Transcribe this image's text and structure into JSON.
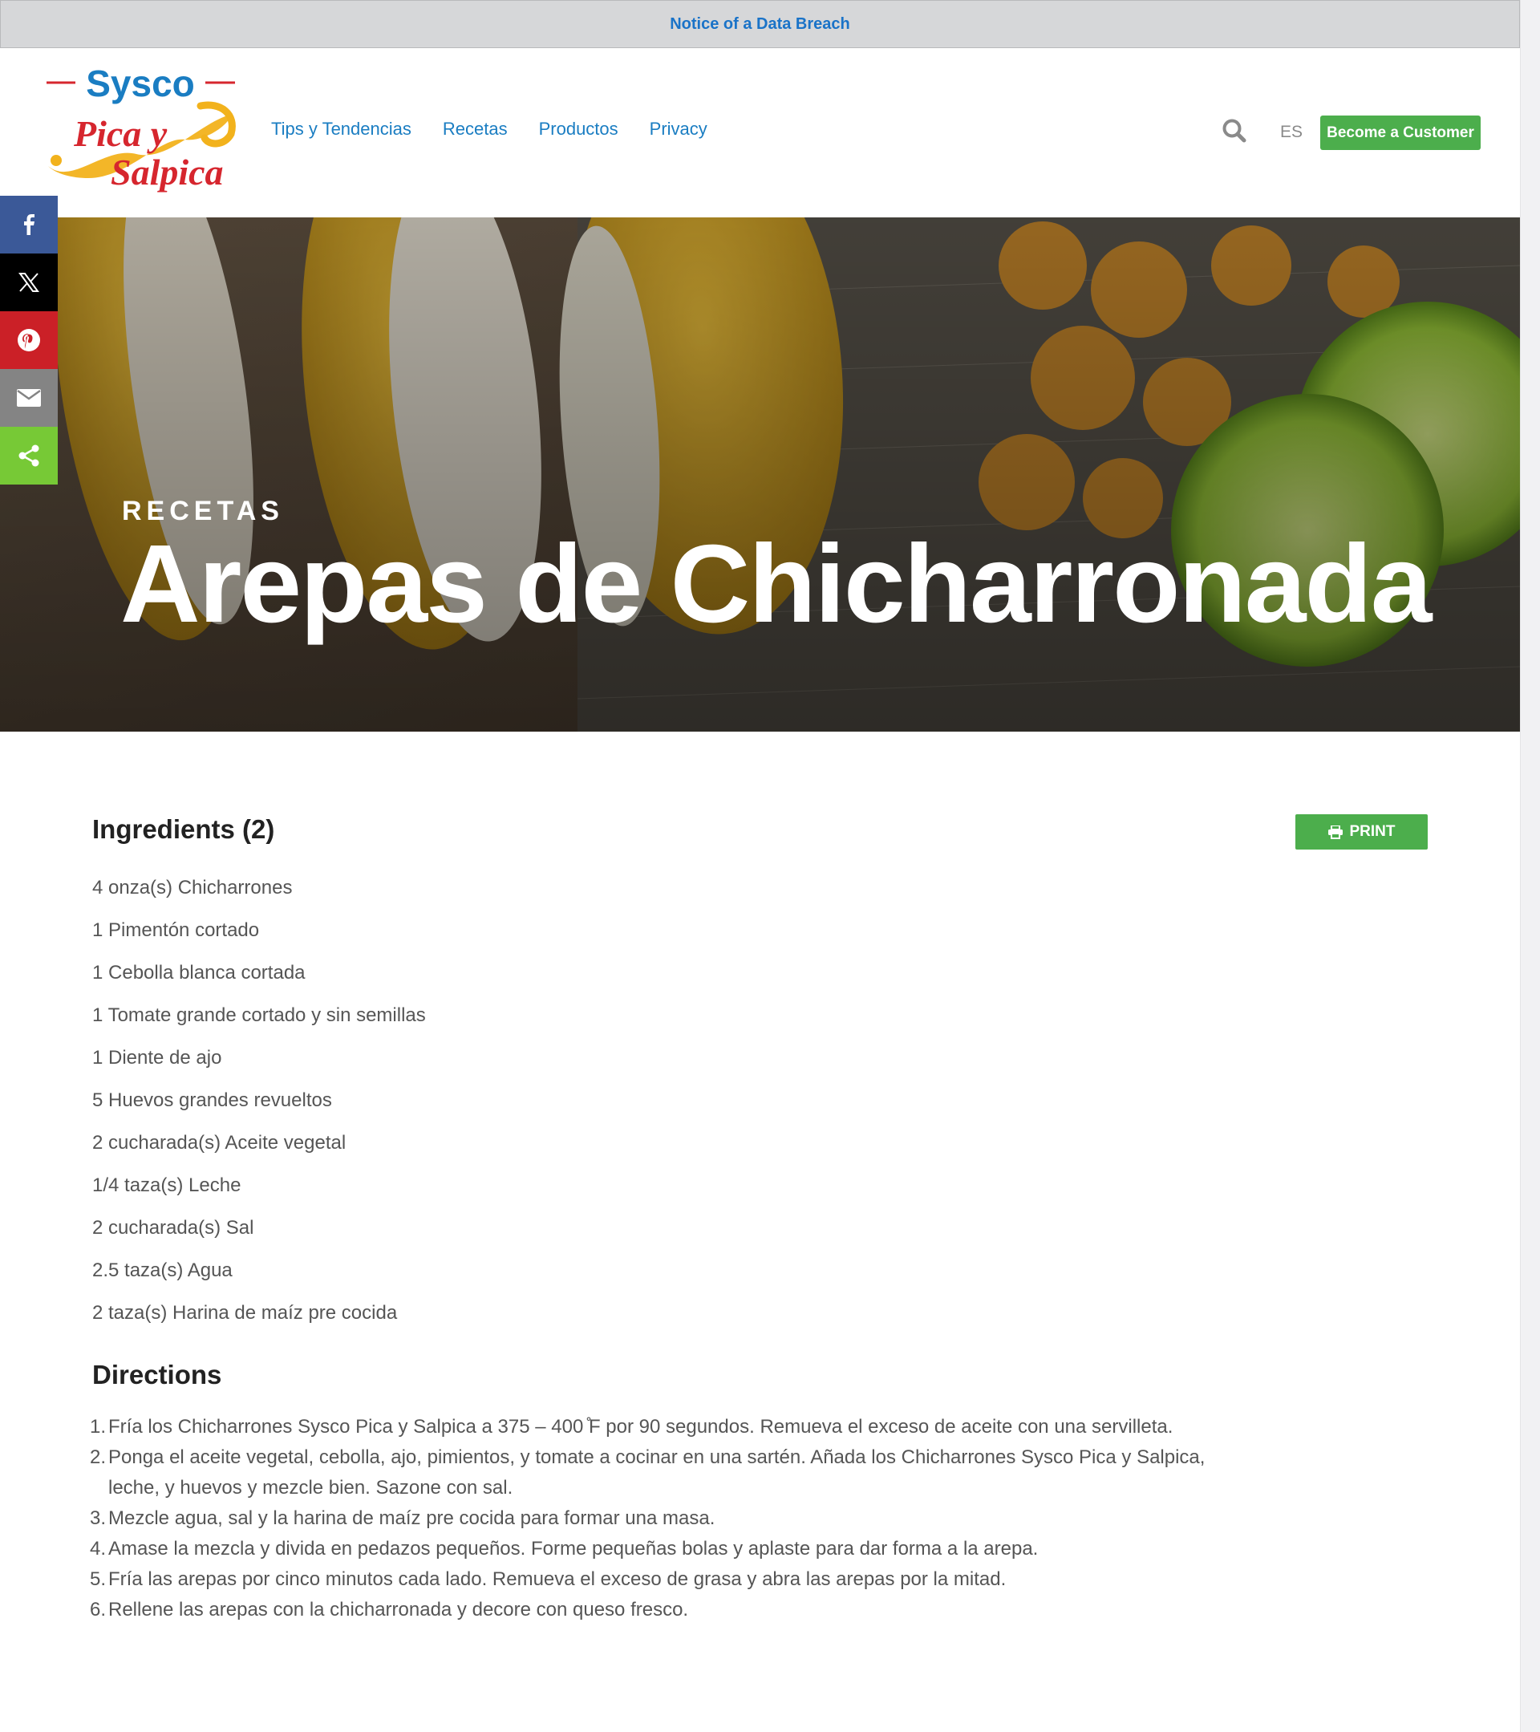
{
  "notice": {
    "text": "Notice of a Data Breach"
  },
  "logo": {
    "brand_top": "Sysco",
    "brand_line1": "Pica y",
    "brand_line2": "Salpica"
  },
  "nav": {
    "items": [
      "Tips y Tendencias",
      "Recetas",
      "Productos",
      "Privacy"
    ]
  },
  "header": {
    "search_icon": "search-icon",
    "lang": "ES",
    "customer_button": "Become a Customer"
  },
  "share": {
    "icons": [
      "facebook-icon",
      "x-icon",
      "pinterest-icon",
      "email-icon",
      "share-icon"
    ]
  },
  "hero": {
    "kicker": "RECETAS",
    "title": "Arepas de Chicharronada"
  },
  "ingredients": {
    "title": "Ingredients (2)",
    "print_label": "PRINT",
    "items": [
      "4 onza(s) Chicharrones",
      "1 Pimentón cortado",
      "1 Cebolla blanca cortada",
      "1 Tomate grande cortado y sin semillas",
      "1 Diente de ajo",
      "5 Huevos grandes revueltos",
      "2 cucharada(s) Aceite vegetal",
      "1/4 taza(s) Leche",
      "2 cucharada(s) Sal",
      "2.5 taza(s) Agua",
      "2 taza(s) Harina de maíz pre cocida"
    ]
  },
  "directions": {
    "title": "Directions",
    "steps": [
      "Fría los Chicharrones Sysco Pica y Salpica a 375 – 400 ̊F por 90 segundos. Remueva el exceso de aceite con una servilleta.",
      "Ponga el aceite vegetal, cebolla, ajo, pimientos, y tomate a cocinar en una sartén. Añada los Chicharrones Sysco Pica y Salpica, leche, y huevos y mezcle bien. Sazone con sal.",
      "Mezcle agua, sal y la harina de maíz pre cocida para formar una masa.",
      "Amase la mezcla y divida en pedazos pequeños. Forme pequeñas bolas y aplaste para dar forma a la arepa.",
      "Fría las arepas por cinco minutos cada lado. Remueva el exceso de grasa y abra las arepas por la mitad.",
      "Rellene las arepas con la chicharronada y decore con queso fresco."
    ]
  }
}
